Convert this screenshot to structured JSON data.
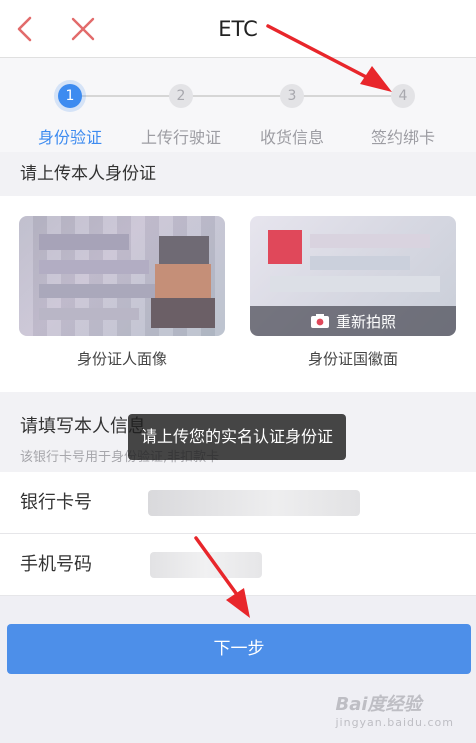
{
  "nav": {
    "title": "ETC"
  },
  "steps": [
    {
      "num": "1",
      "label": "身份验证",
      "active": true
    },
    {
      "num": "2",
      "label": "上传行驶证",
      "active": false
    },
    {
      "num": "3",
      "label": "收货信息",
      "active": false
    },
    {
      "num": "4",
      "label": "签约绑卡",
      "active": false
    }
  ],
  "id_section": {
    "heading": "请上传本人身份证",
    "front_caption": "身份证人面像",
    "back_caption": "身份证国徽面",
    "retake_label": "重新拍照"
  },
  "info_section": {
    "heading": "请填写本人信息",
    "subtitle": "该银行卡号用于身份验证,非扣款卡"
  },
  "fields": {
    "bank_card_label": "银行卡号",
    "phone_label": "手机号码"
  },
  "toast": {
    "text": "请上传您的实名认证身份证"
  },
  "next_button": {
    "label": "下一步"
  },
  "watermark": {
    "brand": "Bai度经验",
    "sub": "jingyan.baidu.com"
  },
  "colors": {
    "accent": "#3d8bf0",
    "button": "#4d8fe9",
    "annotation": "#e8262b"
  }
}
